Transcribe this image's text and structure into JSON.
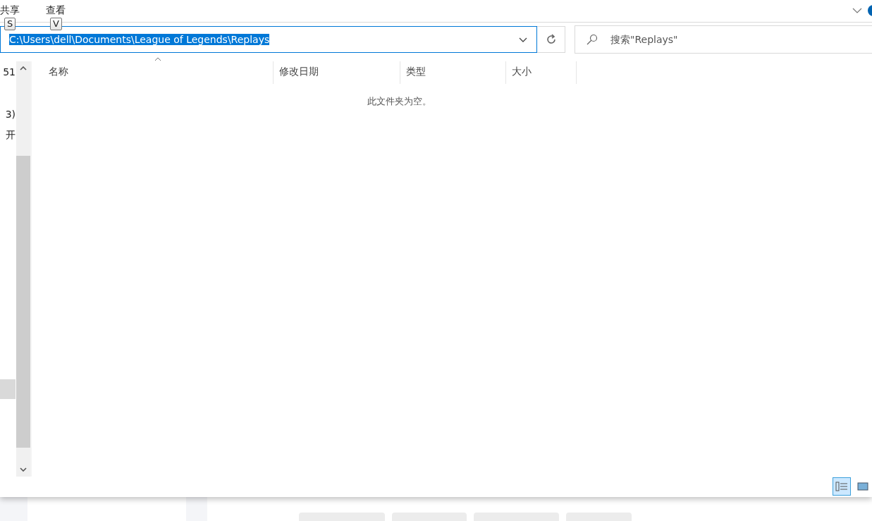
{
  "ribbon": {
    "tabs": [
      {
        "label": "共享",
        "key_tip": "S"
      },
      {
        "label": "查看",
        "key_tip": "V"
      }
    ]
  },
  "address_bar": {
    "path": "C:\\Users\\dell\\Documents\\League of Legends\\Replays",
    "selected": true
  },
  "search": {
    "placeholder": "搜索\"Replays\""
  },
  "navigation_pane": {
    "items": [
      {
        "label": "51",
        "selected": false
      },
      {
        "label": "3)",
        "selected": false
      },
      {
        "label": "开",
        "selected": false
      },
      {
        "selected": true
      }
    ]
  },
  "file_list": {
    "columns": [
      {
        "label": "名称",
        "sorted": true
      },
      {
        "label": "修改日期",
        "sorted": false
      },
      {
        "label": "类型",
        "sorted": false
      },
      {
        "label": "大小",
        "sorted": false
      }
    ],
    "empty_message": "此文件夹为空。"
  },
  "status_bar": {
    "views": [
      {
        "kind": "details",
        "selected": true
      },
      {
        "kind": "thumbnails",
        "selected": false
      }
    ]
  }
}
